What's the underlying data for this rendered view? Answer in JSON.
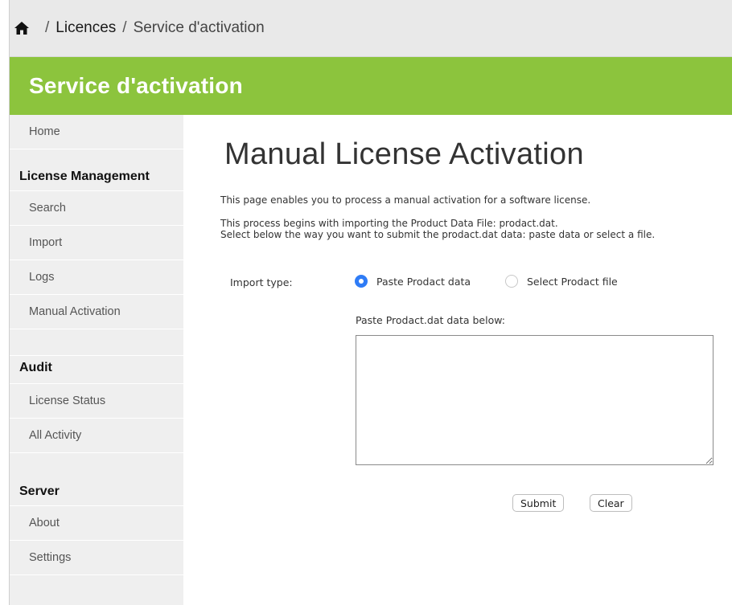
{
  "breadcrumb": {
    "home_icon": "home-icon",
    "separator": "/",
    "items": [
      "Licences",
      "Service d'activation"
    ]
  },
  "banner": {
    "title": "Service d'activation"
  },
  "sidebar": {
    "home": "Home",
    "license_management": {
      "heading": "License Management",
      "items": [
        "Search",
        "Import",
        "Logs",
        "Manual Activation"
      ]
    },
    "audit": {
      "heading": "Audit",
      "items": [
        "License Status",
        "All Activity"
      ]
    },
    "server": {
      "heading": "Server",
      "items": [
        "About",
        "Settings"
      ]
    }
  },
  "main": {
    "title": "Manual License Activation",
    "description": [
      "This page enables you to process a manual activation for a software license.",
      "This process begins with importing the Product Data File: prodact.dat.",
      "Select below the way you want to submit the prodact.dat data: paste data or select a file."
    ],
    "import_type_label": "Import type:",
    "radio_options": [
      {
        "label": "Paste Prodact data",
        "checked": true
      },
      {
        "label": "Select Prodact file",
        "checked": false
      }
    ],
    "paste_label": "Paste Prodact.dat data below:",
    "paste_value": "",
    "submit_label": "Submit",
    "clear_label": "Clear"
  },
  "colors": {
    "banner": "#8cc43d",
    "radio_selected": "#2f7cf6",
    "sidebar_bg": "#efefef",
    "breadcrumb_bg": "#e9e9e9"
  }
}
